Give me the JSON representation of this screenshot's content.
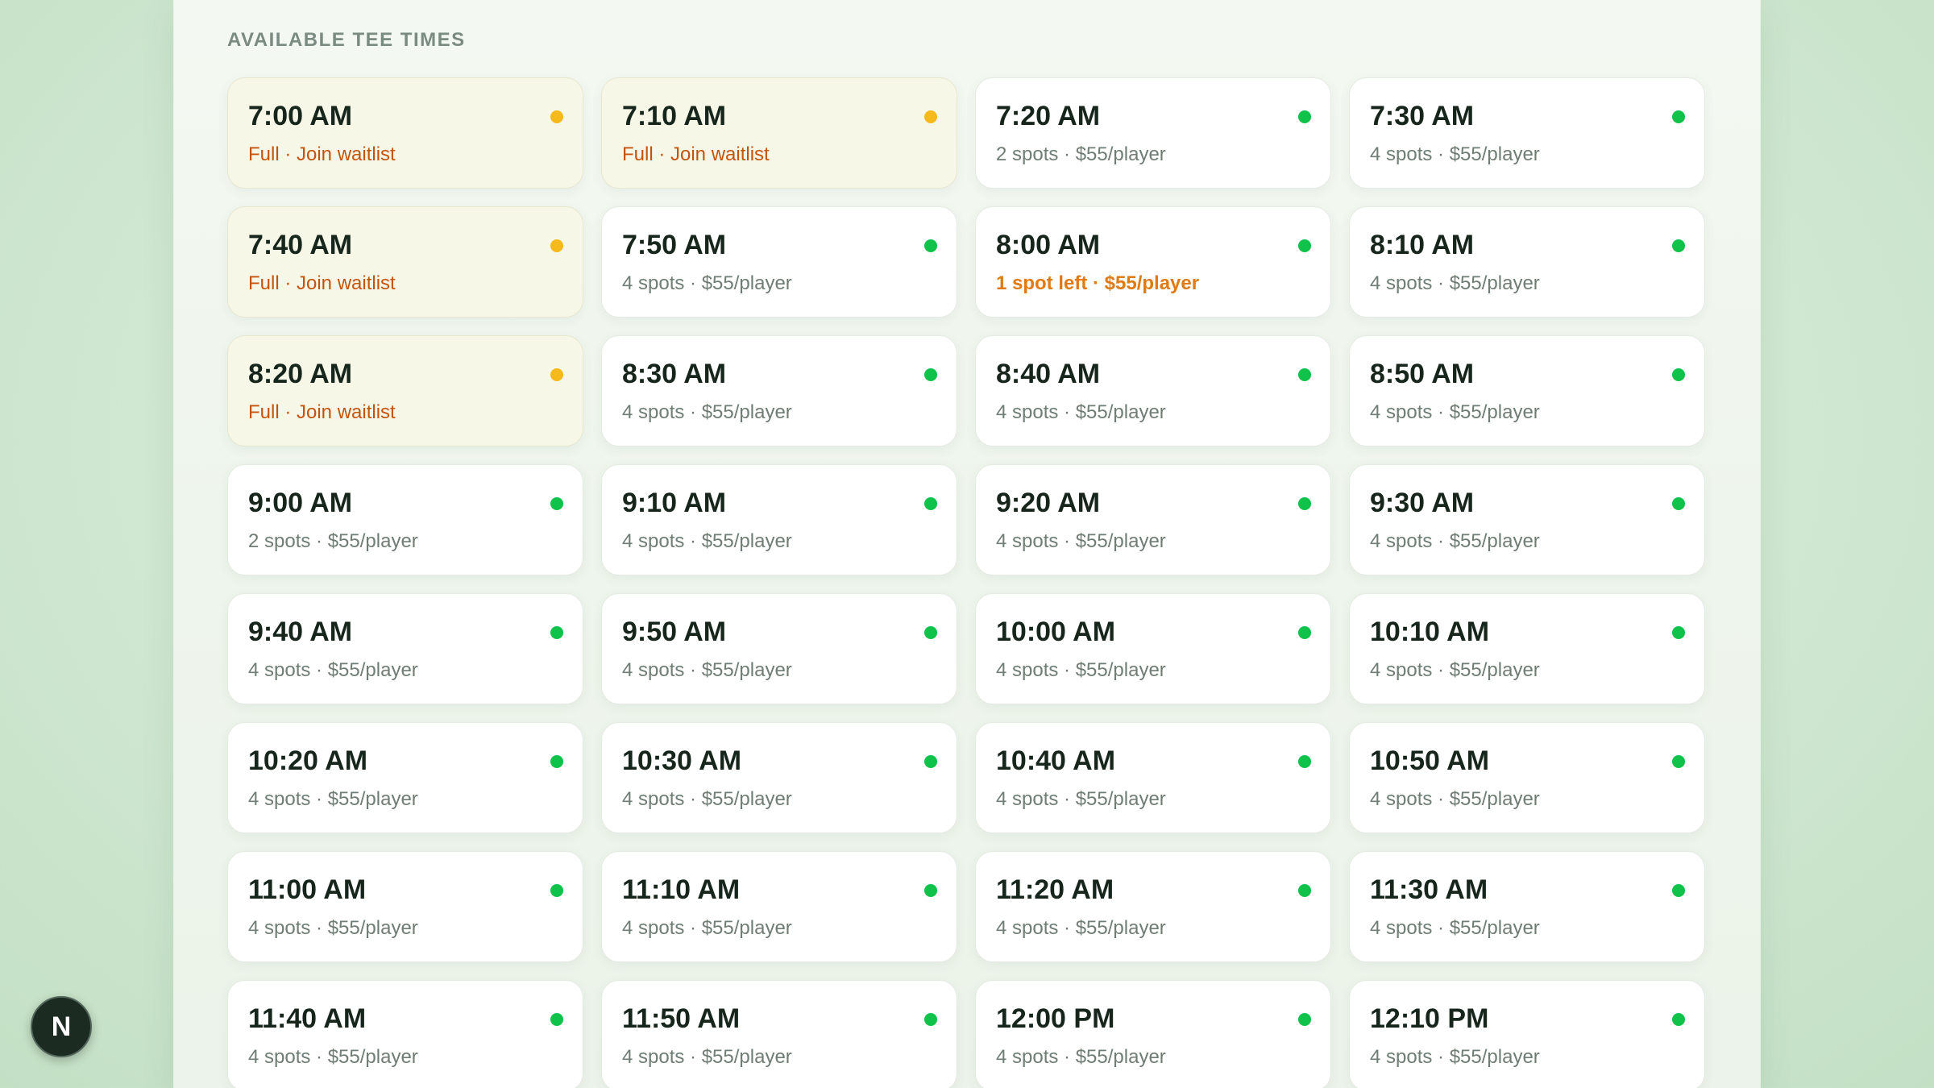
{
  "section_title": "AVAILABLE TEE TIMES",
  "colors": {
    "available": "#10c24a",
    "full": "#f6b91c",
    "waitlist_text": "#c4530c",
    "low_text": "#e07a12"
  },
  "dev_badge": {
    "letter": "N",
    "icon": "next-logo-icon"
  },
  "slots": [
    {
      "time": "7:00 AM",
      "status": "Full · Join waitlist",
      "state": "full"
    },
    {
      "time": "7:10 AM",
      "status": "Full · Join waitlist",
      "state": "full"
    },
    {
      "time": "7:20 AM",
      "status": "2 spots · $55/player",
      "state": "open"
    },
    {
      "time": "7:30 AM",
      "status": "4 spots · $55/player",
      "state": "open"
    },
    {
      "time": "7:40 AM",
      "status": "Full · Join waitlist",
      "state": "full"
    },
    {
      "time": "7:50 AM",
      "status": "4 spots · $55/player",
      "state": "open"
    },
    {
      "time": "8:00 AM",
      "status": "1 spot left · $55/player",
      "state": "low"
    },
    {
      "time": "8:10 AM",
      "status": "4 spots · $55/player",
      "state": "open"
    },
    {
      "time": "8:20 AM",
      "status": "Full · Join waitlist",
      "state": "full"
    },
    {
      "time": "8:30 AM",
      "status": "4 spots · $55/player",
      "state": "open"
    },
    {
      "time": "8:40 AM",
      "status": "4 spots · $55/player",
      "state": "open"
    },
    {
      "time": "8:50 AM",
      "status": "4 spots · $55/player",
      "state": "open"
    },
    {
      "time": "9:00 AM",
      "status": "2 spots · $55/player",
      "state": "open"
    },
    {
      "time": "9:10 AM",
      "status": "4 spots · $55/player",
      "state": "open"
    },
    {
      "time": "9:20 AM",
      "status": "4 spots · $55/player",
      "state": "open"
    },
    {
      "time": "9:30 AM",
      "status": "4 spots · $55/player",
      "state": "open"
    },
    {
      "time": "9:40 AM",
      "status": "4 spots · $55/player",
      "state": "open"
    },
    {
      "time": "9:50 AM",
      "status": "4 spots · $55/player",
      "state": "open"
    },
    {
      "time": "10:00 AM",
      "status": "4 spots · $55/player",
      "state": "open"
    },
    {
      "time": "10:10 AM",
      "status": "4 spots · $55/player",
      "state": "open"
    },
    {
      "time": "10:20 AM",
      "status": "4 spots · $55/player",
      "state": "open"
    },
    {
      "time": "10:30 AM",
      "status": "4 spots · $55/player",
      "state": "open"
    },
    {
      "time": "10:40 AM",
      "status": "4 spots · $55/player",
      "state": "open"
    },
    {
      "time": "10:50 AM",
      "status": "4 spots · $55/player",
      "state": "open"
    },
    {
      "time": "11:00 AM",
      "status": "4 spots · $55/player",
      "state": "open"
    },
    {
      "time": "11:10 AM",
      "status": "4 spots · $55/player",
      "state": "open"
    },
    {
      "time": "11:20 AM",
      "status": "4 spots · $55/player",
      "state": "open"
    },
    {
      "time": "11:30 AM",
      "status": "4 spots · $55/player",
      "state": "open"
    },
    {
      "time": "11:40 AM",
      "status": "4 spots · $55/player",
      "state": "open"
    },
    {
      "time": "11:50 AM",
      "status": "4 spots · $55/player",
      "state": "open"
    },
    {
      "time": "12:00 PM",
      "status": "4 spots · $55/player",
      "state": "open"
    },
    {
      "time": "12:10 PM",
      "status": "4 spots · $55/player",
      "state": "open"
    }
  ]
}
